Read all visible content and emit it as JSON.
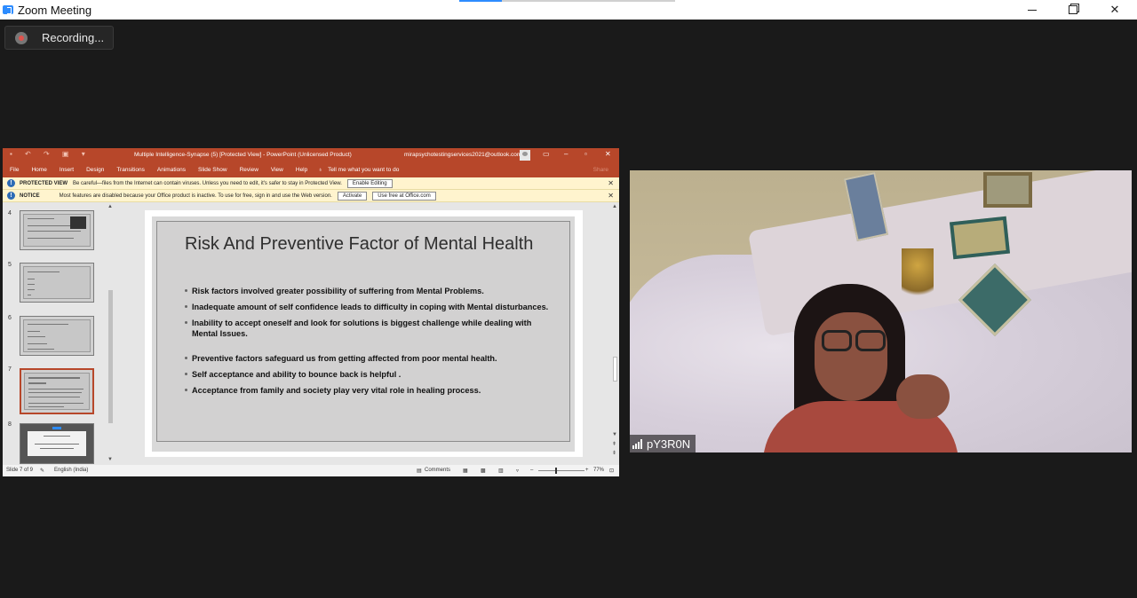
{
  "zoom": {
    "window_title": "Zoom Meeting",
    "recording_label": "Recording...",
    "close_glyph": "✕"
  },
  "ppt": {
    "doc_title": "Multiple Intelligence-Synapse (5) [Protected View]  -  PowerPoint (Unlicensed Product)",
    "user_email": "mirapsychotestingservices2021@outlook.com",
    "ribbon_tabs": [
      "File",
      "Home",
      "Insert",
      "Design",
      "Transitions",
      "Animations",
      "Slide Show",
      "Review",
      "View",
      "Help"
    ],
    "tell_me": "Tell me what you want to do",
    "share": "Share",
    "protected_banner": {
      "label": "PROTECTED VIEW",
      "message": "Be careful—files from the Internet can contain viruses. Unless you need to edit, it's safer to stay in Protected View.",
      "button": "Enable Editing"
    },
    "notice_banner": {
      "label": "NOTICE",
      "message": "Most features are disabled because your Office product is inactive. To use for free, sign in and use the Web version.",
      "button1": "Activate",
      "button2": "Use free at Office.com"
    },
    "thumbnails": [
      {
        "num": "4"
      },
      {
        "num": "5"
      },
      {
        "num": "6"
      },
      {
        "num": "7"
      },
      {
        "num": "8"
      }
    ],
    "slide": {
      "title": "Risk And Preventive Factor of Mental Health",
      "bullets": [
        "Risk factors involved greater possibility of suffering from Mental Problems.",
        "Inadequate amount of self confidence leads to difficulty in coping with Mental disturbances.",
        "Inability to accept oneself and look for solutions is biggest challenge while dealing with Mental Issues.",
        "Preventive factors safeguard us from getting affected from poor mental health.",
        "Self acceptance and ability to bounce back is helpful .",
        "Acceptance from family and society play very vital role in healing process."
      ]
    },
    "status": {
      "slide_count": "Slide 7 of 9",
      "language": "English (India)",
      "comments": "Comments",
      "zoom": "77%"
    }
  },
  "video": {
    "participant_name": "pY3R0N"
  }
}
